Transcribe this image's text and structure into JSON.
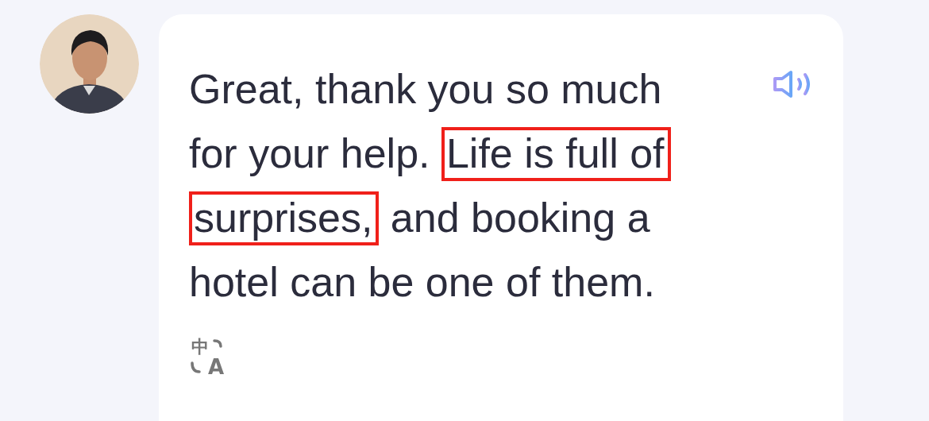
{
  "message": {
    "segments": [
      {
        "text": "Great, thank you so much for your help. ",
        "highlighted": false
      },
      {
        "text": "Life is full of surprises,",
        "highlighted": true
      },
      {
        "text": " and booking a hotel can be one of them.",
        "highlighted": false
      }
    ],
    "translate": {
      "source_glyph": "中",
      "target_glyph": "A"
    }
  }
}
